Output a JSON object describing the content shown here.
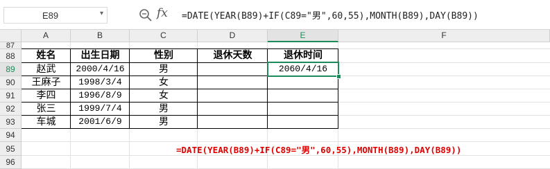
{
  "formula_bar": {
    "name_box": "E89",
    "formula": "=DATE(YEAR(B89)+IF(C89=\"男\",60,55),MONTH(B89),DAY(B89))"
  },
  "columns": [
    "A",
    "B",
    "C",
    "D",
    "E",
    "F"
  ],
  "selected_column": "E",
  "rows": [
    "87",
    "88",
    "89",
    "90",
    "91",
    "92",
    "93",
    "94",
    "95",
    "96"
  ],
  "selected_row": "89",
  "table": {
    "headers": [
      "姓名",
      "出生日期",
      "性别",
      "退休天数",
      "退休时间"
    ],
    "records": [
      [
        "赵武",
        "2000/4/16",
        "男",
        "",
        "2060/4/16"
      ],
      [
        "王麻子",
        "1998/3/4",
        "女",
        "",
        ""
      ],
      [
        "李四",
        "1996/8/9",
        "女",
        "",
        ""
      ],
      [
        "张三",
        "1999/7/4",
        "男",
        "",
        ""
      ],
      [
        "车城",
        "2001/6/9",
        "男",
        "",
        ""
      ]
    ]
  },
  "annotation": "=DATE(YEAR(B89)+IF(C89=\"男\",60,55),MONTH(B89),DAY(B89))",
  "colors": {
    "accent": "#1e8a5a",
    "annotation": "#e00000"
  },
  "icons": [
    "zoom-icon",
    "fx-icon",
    "chevron-down-icon"
  ]
}
